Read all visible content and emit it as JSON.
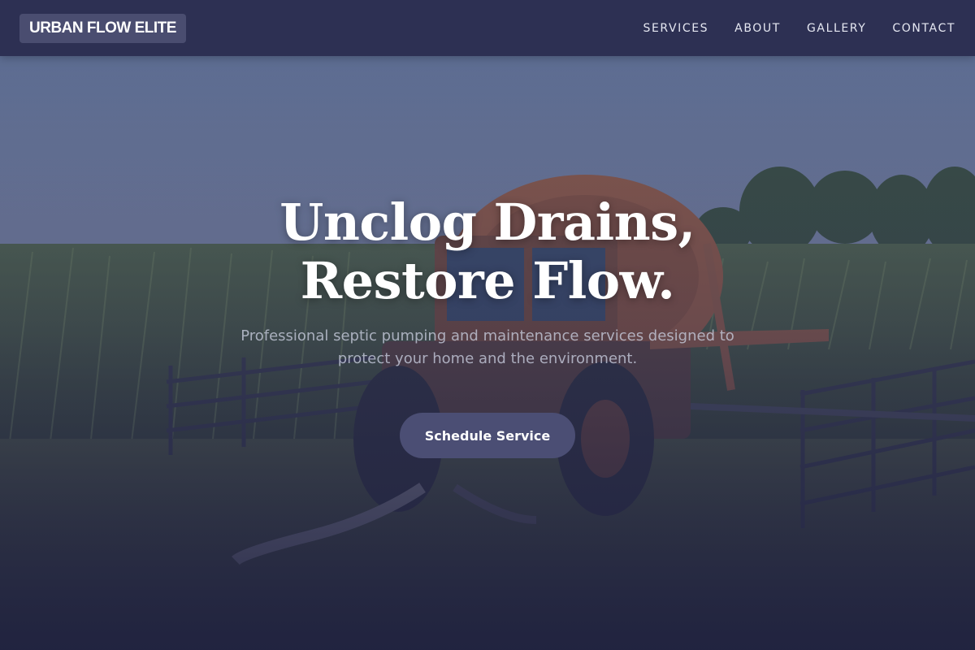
{
  "brand": {
    "name": "URBAN FLOW ELITE"
  },
  "nav": {
    "items": [
      "SERVICES",
      "ABOUT",
      "GALLERY",
      "CONTACT"
    ]
  },
  "hero": {
    "headline_line1": "Unclog Drains,",
    "headline_line2": "Restore Flow.",
    "subtext": "Professional septic pumping and maintenance services designed to protect your home and the environment.",
    "cta_label": "Schedule Service",
    "background_image": "tractor-in-cornfield-photo"
  },
  "colors": {
    "navbar_bg": "#2c2e50",
    "logo_bg": "#4a4d70",
    "cta_bg": "#4b4e74",
    "text_primary": "#ffffff"
  }
}
